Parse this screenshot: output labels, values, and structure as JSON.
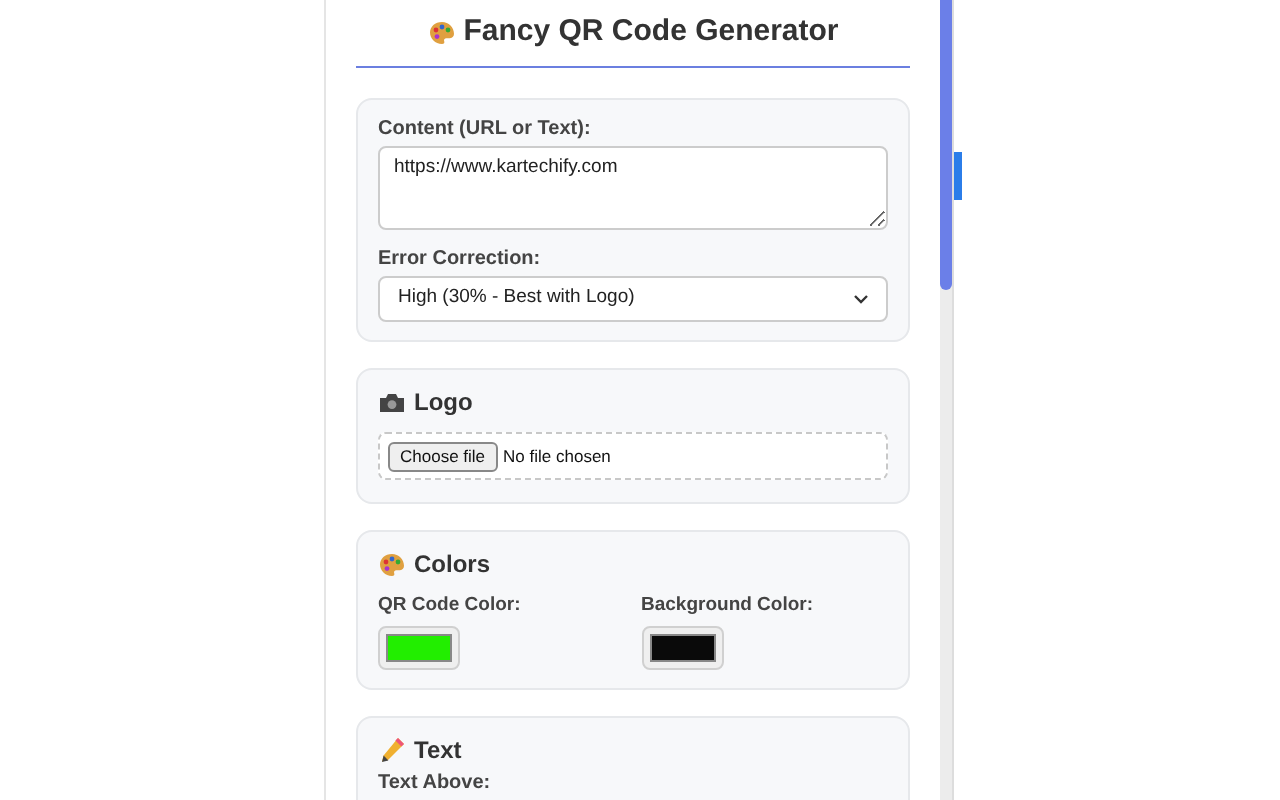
{
  "popup": {
    "title": "Fancy QR Code Generator",
    "content_section": {
      "content_label": "Content (URL or Text):",
      "content_value": "https://www.kartechify.com",
      "error_label": "Error Correction:",
      "error_value": "High (30% - Best with Logo)"
    },
    "logo_section": {
      "heading": "Logo",
      "button": "Choose file",
      "file_status": "No file chosen"
    },
    "colors_section": {
      "heading": "Colors",
      "pickers": [
        {
          "label": "QR Code Color:",
          "color": "#22ee00"
        },
        {
          "label": "Background Color:",
          "color": "#0a0a0a"
        }
      ]
    },
    "text_section": {
      "heading": "Text",
      "field_label": "Text Above:"
    }
  }
}
